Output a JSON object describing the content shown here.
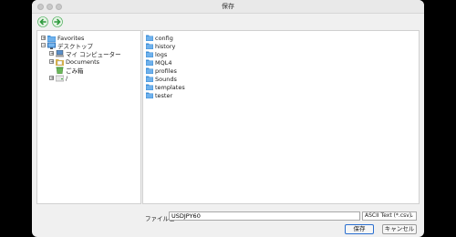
{
  "window": {
    "title": "保存"
  },
  "tree": {
    "items": [
      {
        "label": "Favorites",
        "expander": "+",
        "icon": "favorites-folder-icon"
      },
      {
        "label": "デスクトップ",
        "expander": "−",
        "icon": "desktop-icon"
      },
      {
        "label": "マイ コンピューター",
        "expander": "+",
        "icon": "computer-icon"
      },
      {
        "label": "Documents",
        "expander": "+",
        "icon": "documents-icon"
      },
      {
        "label": "ごみ箱",
        "expander": "",
        "icon": "trash-icon"
      },
      {
        "label": "/",
        "expander": "+",
        "icon": "drive-icon"
      }
    ]
  },
  "files": [
    {
      "name": "config"
    },
    {
      "name": "history"
    },
    {
      "name": "logs"
    },
    {
      "name": "MQL4"
    },
    {
      "name": "profiles"
    },
    {
      "name": "Sounds"
    },
    {
      "name": "templates"
    },
    {
      "name": "tester"
    }
  ],
  "footer": {
    "filename_label": "ファイル名:",
    "filename_value": "USDJPY60",
    "filetype_value": "ASCII Text (*.csv)",
    "save_label": "保存",
    "cancel_label": "キャンセル"
  },
  "colors": {
    "folder": "#3d8fd8",
    "nav_arrow": "#3aa84a"
  }
}
